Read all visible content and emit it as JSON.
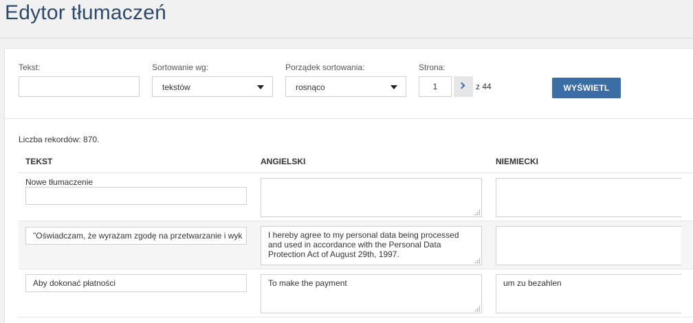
{
  "page": {
    "title": "Edytor tłumaczeń"
  },
  "filters": {
    "text_label": "Tekst:",
    "text_value": "",
    "sort_by_label": "Sortowanie wg:",
    "sort_by_value": "tekstów",
    "sort_order_label": "Porządek sortowania:",
    "sort_order_value": "rosnąco",
    "page_label": "Strona:",
    "page_value": "1",
    "page_total": "z 44",
    "submit_label": "WYŚWIETL"
  },
  "records": {
    "count_text": "Liczba rekordów: 870."
  },
  "table": {
    "headers": [
      "TEKST",
      "ANGIELSKI",
      "NIEMIECKI"
    ],
    "new_row_label": "Nowe tłumaczenie",
    "rows": [
      {
        "text": "\"Oświadczam, że wyrażam zgodę na przetwarzanie i wyk",
        "english": "I hereby agree to my personal data being processed and used in accordance with the Personal Data Protection Act of August 29th, 1997.",
        "german": ""
      },
      {
        "text": "Aby dokonać płatności",
        "english": "To make the payment",
        "german": "um zu bezahlen"
      }
    ]
  },
  "colors": {
    "title": "#2e4a6b",
    "primary_button": "#3b6ea5",
    "row_shade": "#f5f5f5"
  },
  "icons": {
    "select_caret": "caret-down-icon",
    "next_page": "chevron-right-icon",
    "resize": "resize-grip-icon"
  }
}
